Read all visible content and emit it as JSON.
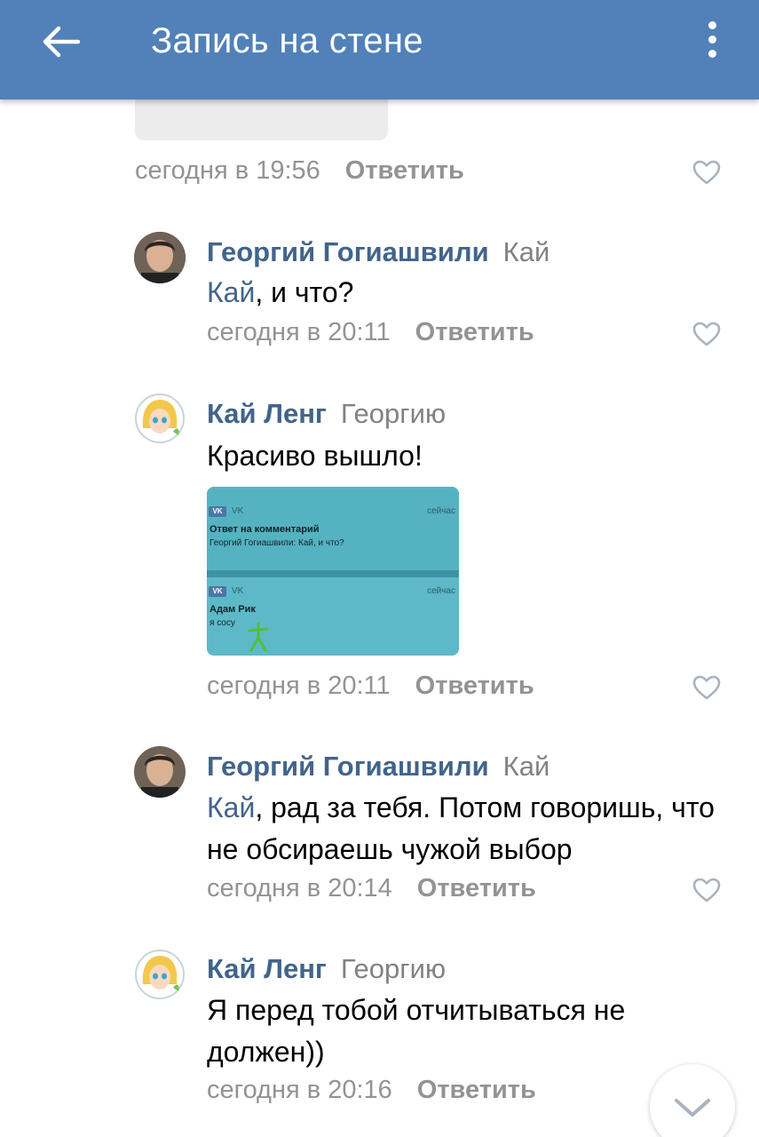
{
  "header": {
    "title": "Запись на стене",
    "back_icon": "arrow-left-icon",
    "menu_icon": "more-vertical-icon",
    "background": "#5181b8"
  },
  "colors": {
    "author": "#42648b",
    "meta": "#939393",
    "text": "#000000"
  },
  "previous_comment": {
    "date": "сегодня в 19:56",
    "reply_label": "Ответить",
    "like_icon": "heart-icon"
  },
  "comments": [
    {
      "author": "Георгий Гогиашвили",
      "reply_to": "Кай",
      "mention": "Кай",
      "text": ", и что?",
      "date": "сегодня в 20:11",
      "reply_label": "Ответить"
    },
    {
      "author": "Кай Ленг",
      "reply_to": "Георгию",
      "text": "Красиво вышло!",
      "date": "сегодня в 20:11",
      "reply_label": "Ответить",
      "attachment": {
        "notif1_app": "VK",
        "notif1_time": "сейчас",
        "notif1_title": "Ответ на комментарий",
        "notif1_text": "Георгий Гогиашвили: Кай, и что?",
        "notif2_app": "VK",
        "notif2_time": "сейчас",
        "notif2_title": "Адам Рик",
        "notif2_text": "я сосу"
      }
    },
    {
      "author": "Георгий Гогиашвили",
      "reply_to": "Кай",
      "mention": "Кай",
      "text": ", рад за тебя. Потом говоришь, что не обсираешь чужой выбор",
      "date": "сегодня в 20:14",
      "reply_label": "Ответить"
    },
    {
      "author": "Кай Ленг",
      "reply_to": "Георгию",
      "text": "Я перед тобой отчитываться не должен))",
      "date": "сегодня в 20:16",
      "reply_label": "Ответить"
    }
  ],
  "scroll_button_icon": "chevron-down-icon"
}
